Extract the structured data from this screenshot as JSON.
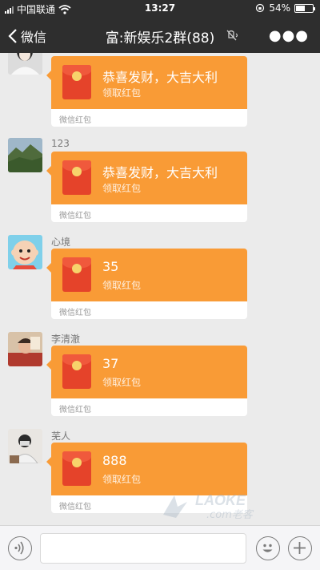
{
  "status_bar": {
    "carrier": "中国联通",
    "time": "13:27",
    "battery_text": "54%",
    "battery_level": 0.54
  },
  "nav": {
    "back_label": "微信",
    "title": "富:新娱乐2群(88)"
  },
  "messages": [
    {
      "sender": "",
      "greeting": "恭喜发财，大吉大利",
      "claim": "领取红包",
      "footer": "微信红包"
    },
    {
      "sender": "123",
      "greeting": "恭喜发财，大吉大利",
      "claim": "领取红包",
      "footer": "微信红包"
    },
    {
      "sender": "心境",
      "greeting": "35",
      "claim": "领取红包",
      "footer": "微信红包"
    },
    {
      "sender": "李清澈",
      "greeting": "37",
      "claim": "领取红包",
      "footer": "微信红包"
    },
    {
      "sender": "芜人",
      "greeting": "888",
      "claim": "领取红包",
      "footer": "微信红包"
    }
  ],
  "watermark": {
    "brand": "LAOKE",
    "sub": ".com老客"
  },
  "colors": {
    "packet": "#f99b36",
    "bar": "#2e2e2e",
    "envelope": "#e5432a"
  },
  "icons": [
    "signal-icon",
    "wifi-icon",
    "battery-icon",
    "back-chevron-icon",
    "mute-icon",
    "more-icon",
    "voice-icon",
    "emoji-icon",
    "plus-icon"
  ]
}
